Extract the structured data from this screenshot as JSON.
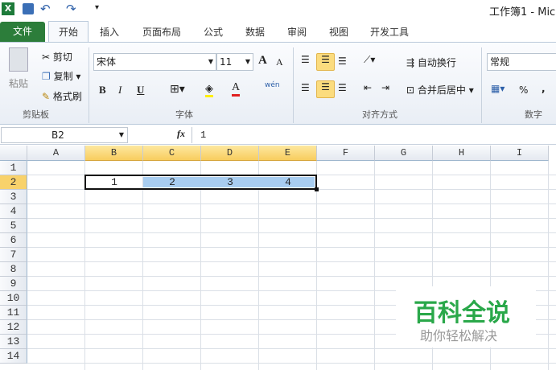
{
  "title": "工作簿1 - Mic",
  "qat": {
    "excel_icon": "excel-icon",
    "save": "save-icon",
    "undo": "undo-icon",
    "redo": "redo-icon",
    "customize": "▾"
  },
  "tabs": [
    "文件",
    "开始",
    "插入",
    "页面布局",
    "公式",
    "数据",
    "审阅",
    "视图",
    "开发工具"
  ],
  "ribbon": {
    "clipboard": {
      "paste": "粘贴",
      "cut": "剪切",
      "copy": "复制",
      "format_painter": "格式刷",
      "group": "剪贴板"
    },
    "font": {
      "name": "宋体",
      "size": "11",
      "bold": "B",
      "italic": "I",
      "underline": "U",
      "grow": "A",
      "shrink": "A",
      "phonetic": "wén",
      "group": "字体"
    },
    "alignment": {
      "wrap": "自动换行",
      "merge": "合并后居中",
      "group": "对齐方式"
    },
    "number": {
      "format": "常规",
      "percent": "%",
      "comma": ",",
      "group": "数字"
    }
  },
  "formula_bar": {
    "name_box": "B2",
    "fx": "fx",
    "value": "1"
  },
  "columns": [
    "A",
    "B",
    "C",
    "D",
    "E",
    "F",
    "G",
    "H",
    "I"
  ],
  "rows": [
    "1",
    "2",
    "3",
    "4",
    "5",
    "6",
    "7",
    "8",
    "9",
    "10",
    "11",
    "12",
    "13",
    "14"
  ],
  "cells": [
    {
      "ref": "B2",
      "value": "1"
    },
    {
      "ref": "C2",
      "value": "2"
    },
    {
      "ref": "D2",
      "value": "3"
    },
    {
      "ref": "E2",
      "value": "4"
    }
  ],
  "watermark": {
    "title": "百科全说",
    "subtitle": "助你轻松解决"
  },
  "colors": {
    "file_tab": "#2c7d3a",
    "selection": "#a8cdf0",
    "header_selected": "#f8cd5e",
    "watermark": "#2aa84a"
  }
}
